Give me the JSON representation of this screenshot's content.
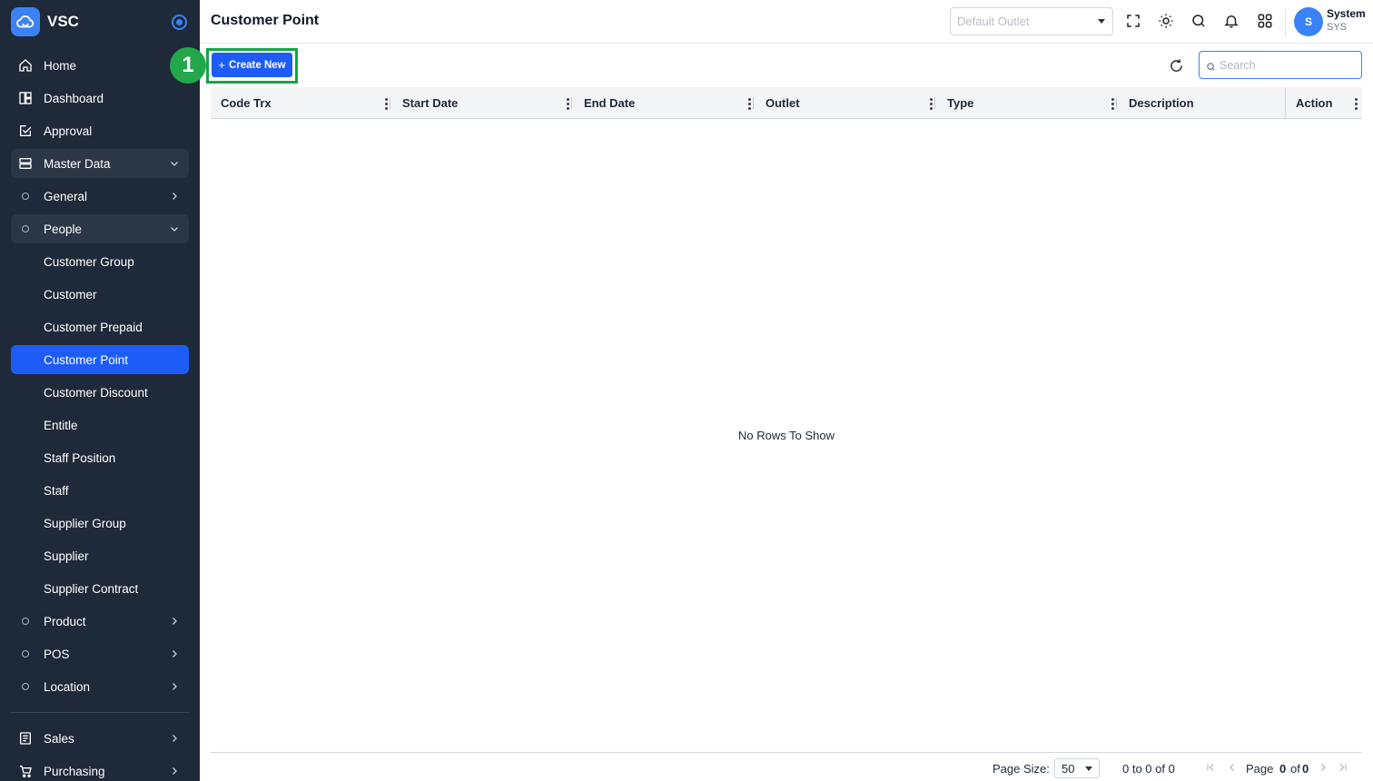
{
  "app": {
    "name": "VSC"
  },
  "header": {
    "title": "Customer Point",
    "outlet_placeholder": "Default Outlet",
    "user": {
      "initial": "S",
      "name": "System",
      "code": "SYS"
    }
  },
  "sidebar": {
    "items": [
      {
        "label": "Home",
        "icon": "home-icon"
      },
      {
        "label": "Dashboard",
        "icon": "dashboard-icon"
      },
      {
        "label": "Approval",
        "icon": "approval-icon"
      },
      {
        "label": "Master Data",
        "icon": "master-data-icon"
      },
      {
        "label": "General"
      },
      {
        "label": "People"
      },
      {
        "label": "Customer Group"
      },
      {
        "label": "Customer"
      },
      {
        "label": "Customer Prepaid"
      },
      {
        "label": "Customer Point"
      },
      {
        "label": "Customer Discount"
      },
      {
        "label": "Entitle"
      },
      {
        "label": "Staff Position"
      },
      {
        "label": "Staff"
      },
      {
        "label": "Supplier Group"
      },
      {
        "label": "Supplier"
      },
      {
        "label": "Supplier Contract"
      },
      {
        "label": "Product"
      },
      {
        "label": "POS"
      },
      {
        "label": "Location"
      },
      {
        "label": "Sales",
        "icon": "sales-icon"
      },
      {
        "label": "Purchasing",
        "icon": "cart-icon"
      }
    ]
  },
  "toolbar": {
    "annotation_number": "1",
    "create_label": "Create New",
    "search_placeholder": "Search"
  },
  "grid": {
    "columns": [
      "Code Trx",
      "Start Date",
      "End Date",
      "Outlet",
      "Type",
      "Description",
      "Action"
    ],
    "empty_message": "No Rows To Show"
  },
  "pagination": {
    "page_size_label": "Page Size:",
    "page_size": "50",
    "range_text": "0 to 0 of 0",
    "page_prefix": "Page",
    "current_page": "0",
    "of_label": "of",
    "total_pages": "0"
  },
  "colors": {
    "sidebar_bg": "#1e2939",
    "accent": "#1d5cf6",
    "highlight": "#16a34a"
  }
}
